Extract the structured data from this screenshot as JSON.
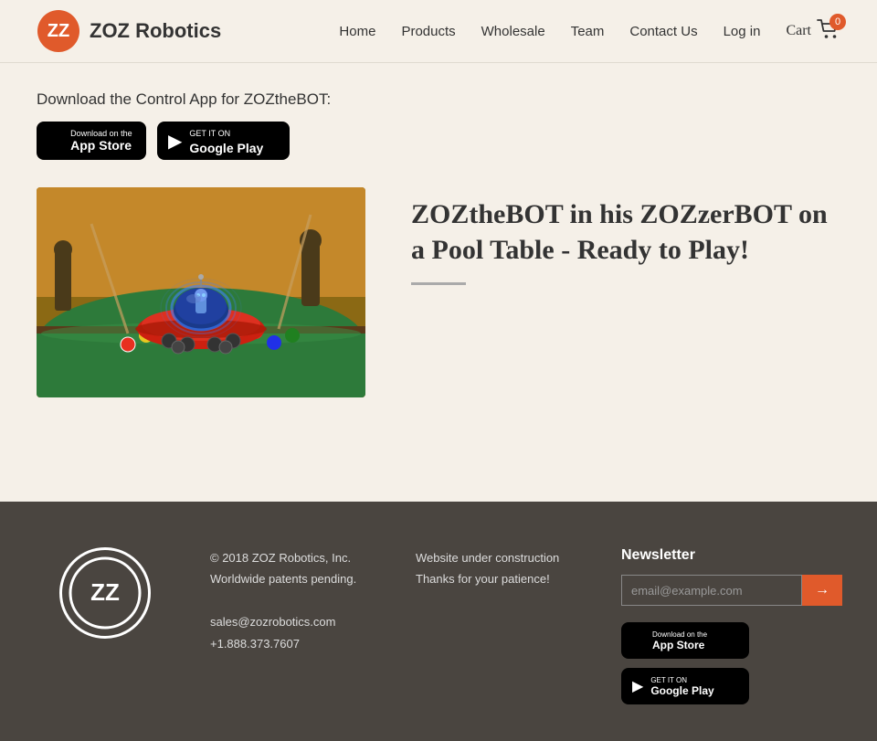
{
  "header": {
    "logo_text": "ZOZ Robotics",
    "nav_items": [
      {
        "label": "Home",
        "href": "#"
      },
      {
        "label": "Products",
        "href": "#"
      },
      {
        "label": "Wholesale",
        "href": "#"
      },
      {
        "label": "Team",
        "href": "#"
      },
      {
        "label": "Contact Us",
        "href": "#"
      },
      {
        "label": "Log in",
        "href": "#"
      }
    ],
    "cart_label": "Cart",
    "cart_count": "0"
  },
  "main": {
    "download_title": "Download the Control App for ZOZtheBOT:",
    "app_store": {
      "small_text": "Download on the",
      "big_text": "App Store"
    },
    "google_play": {
      "small_text": "GET IT ON",
      "big_text": "Google Play"
    },
    "product_title": "ZOZtheBOT in his ZOZzerBOT on a Pool Table - Ready to Play!"
  },
  "footer": {
    "copyright": "© 2018 ZOZ Robotics, Inc.",
    "patents": "Worldwide patents pending.",
    "email": "sales@zozrobotics.com",
    "phone": "+1.888.373.7607",
    "status_line1": "Website under construction",
    "status_line2": "Thanks for your patience!",
    "newsletter_title": "Newsletter",
    "newsletter_placeholder": "email@example.com",
    "app_store": {
      "small_text": "Download on the",
      "big_text": "App Store"
    },
    "google_play": {
      "small_text": "GET IT ON",
      "big_text": "Google Play"
    }
  },
  "icons": {
    "cart": "🛒",
    "apple": "",
    "play_triangle": "▶",
    "arrow_right": "→"
  }
}
